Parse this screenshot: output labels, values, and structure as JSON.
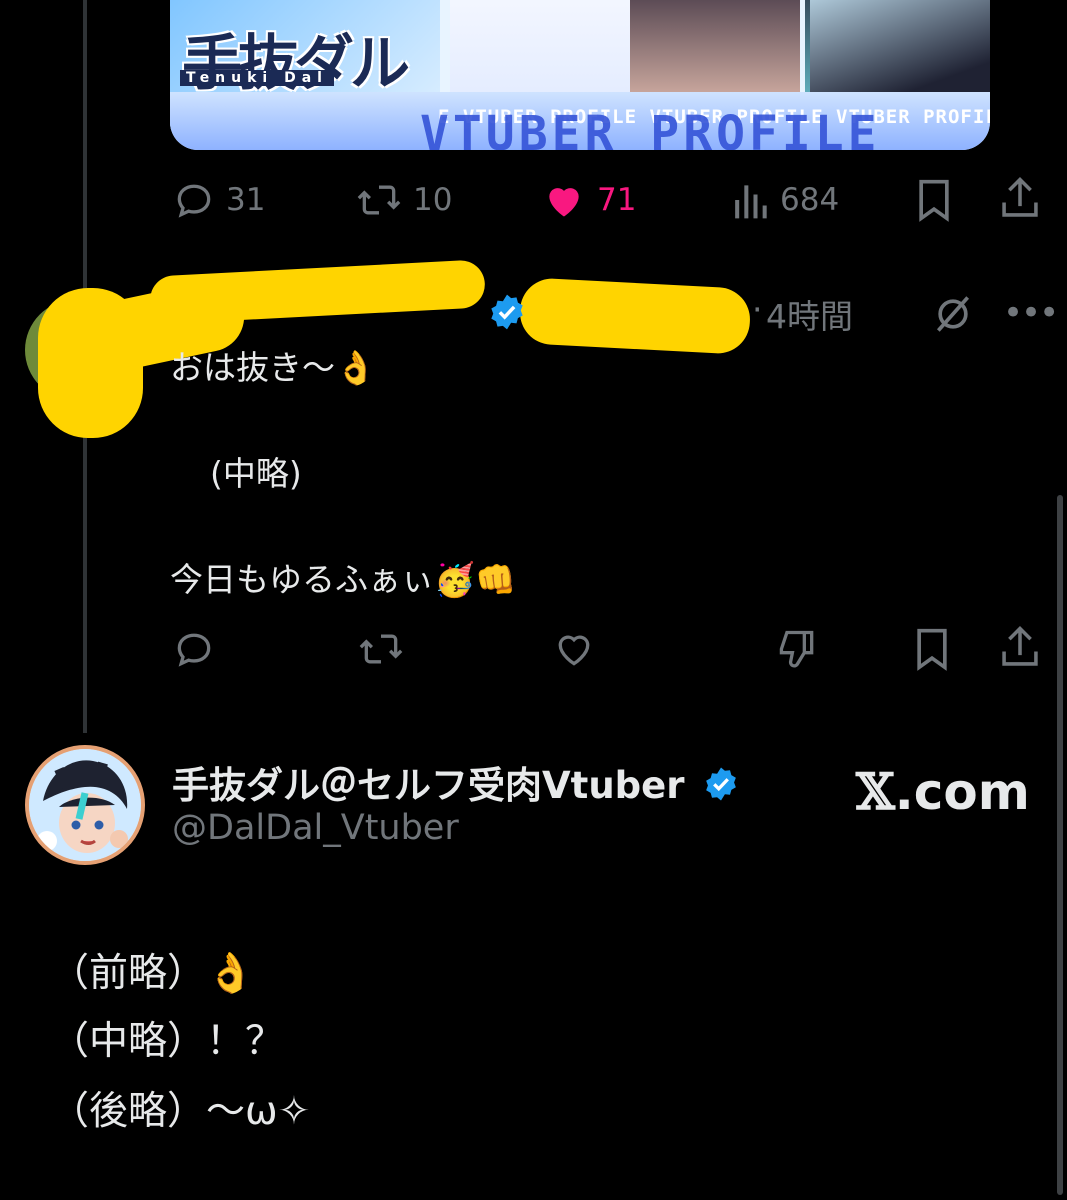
{
  "media": {
    "logo_jp": "手抜ダル",
    "logo_romaji": "Tenuki Dal",
    "banner_repeat": "E VTUBER PROFILE VTUBER PROFILE VTUBER PROFILE",
    "banner_big": "VTUBER PROFILE"
  },
  "parent_actions": {
    "replies": "31",
    "reposts": "10",
    "likes": "71",
    "views": "684",
    "liked": true,
    "accent_like": "#f91880"
  },
  "reply": {
    "dot": "·",
    "time": "4時間",
    "line1": "おは抜き～👌",
    "line2": "(中略)",
    "line3": "今日もゆるふぁぃ🥳👊"
  },
  "profile": {
    "name": "手抜ダル＠セルフ受肉Vtuber",
    "handle": "@DalDal_Vtuber",
    "site_x": "𝕏",
    "site_rest": ".com"
  },
  "quote": {
    "line1": "（前略）👌",
    "line2": "（中略）！？",
    "line3": "（後略）～ω✧"
  },
  "colors": {
    "verified": "#1d9bf0",
    "redaction": "#ffd400"
  }
}
